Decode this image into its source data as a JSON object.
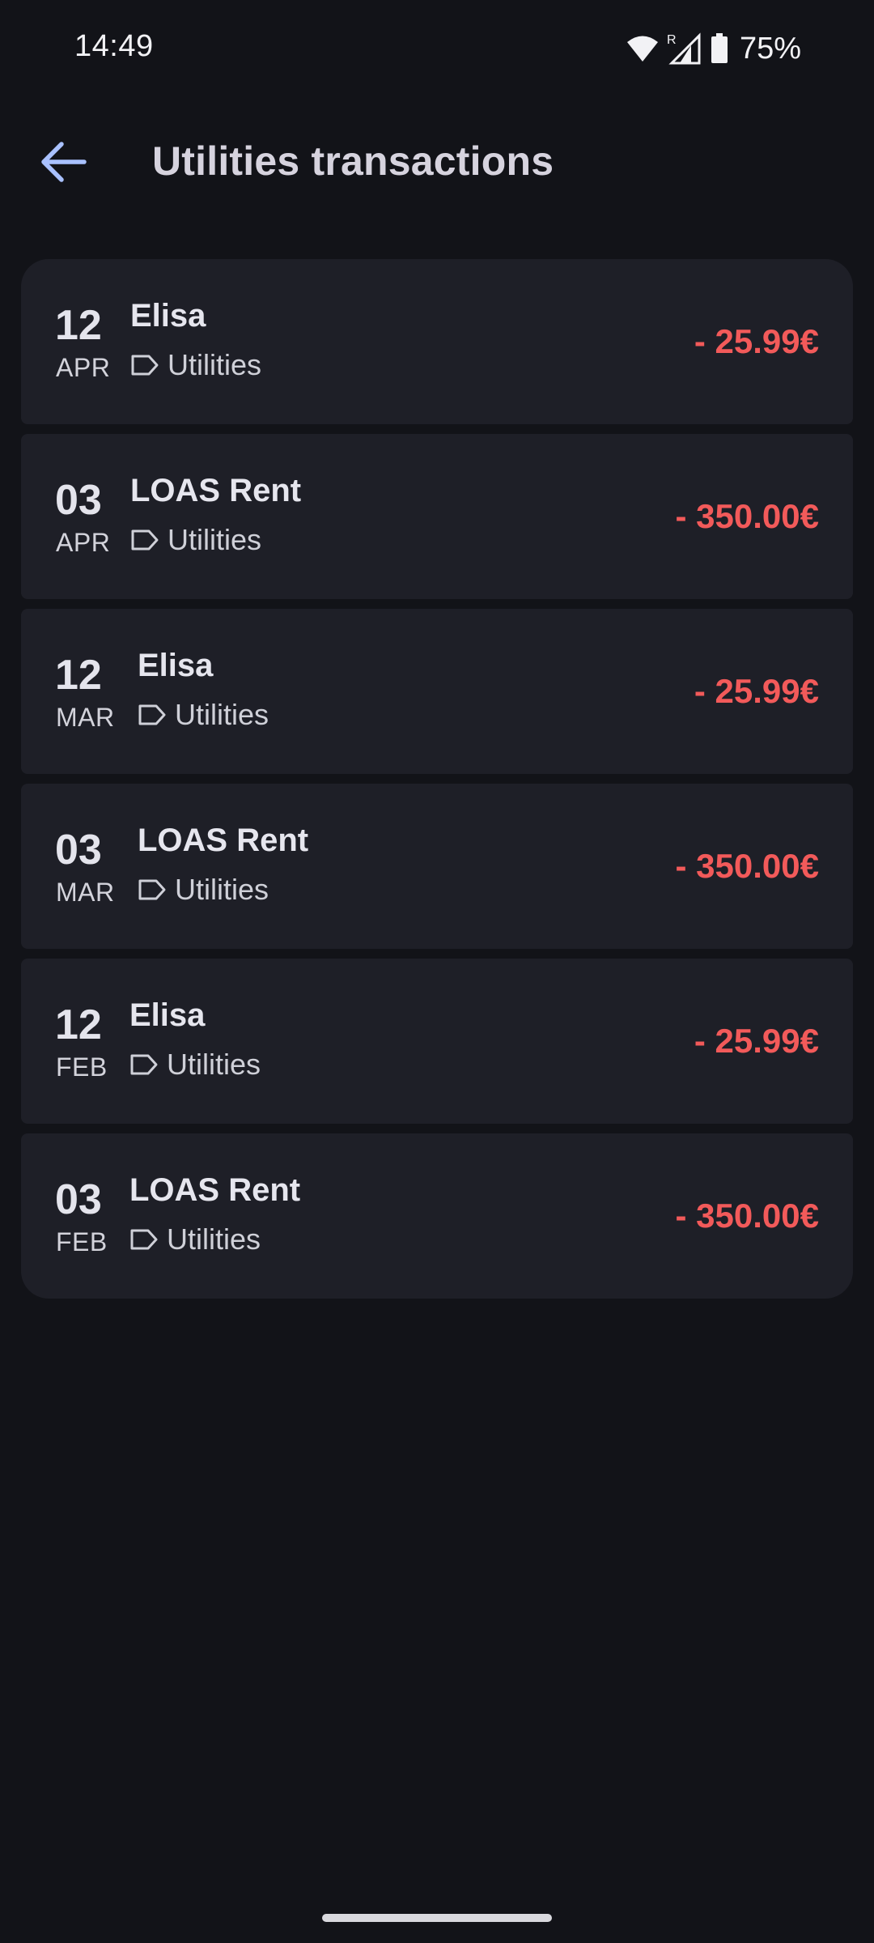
{
  "status_bar": {
    "time": "14:49",
    "battery": "75%",
    "icons": [
      "wifi-icon",
      "signal-roaming-icon",
      "battery-icon"
    ]
  },
  "app_bar": {
    "back_icon": "arrow-left-icon",
    "title": "Utilities transactions"
  },
  "colors": {
    "background": "#121318",
    "card": "#1e1f27",
    "expense": "#f25a5a",
    "accent": "#a9c1ff"
  },
  "transactions": [
    {
      "day": "12",
      "month": "APR",
      "name": "Elisa",
      "category": "Utilities",
      "amount": "- 25.99€"
    },
    {
      "day": "03",
      "month": "APR",
      "name": "LOAS Rent",
      "category": "Utilities",
      "amount": "- 350.00€"
    },
    {
      "day": "12",
      "month": "MAR",
      "name": "Elisa",
      "category": "Utilities",
      "amount": "- 25.99€"
    },
    {
      "day": "03",
      "month": "MAR",
      "name": "LOAS Rent",
      "category": "Utilities",
      "amount": "- 350.00€"
    },
    {
      "day": "12",
      "month": "FEB",
      "name": "Elisa",
      "category": "Utilities",
      "amount": "- 25.99€"
    },
    {
      "day": "03",
      "month": "FEB",
      "name": "LOAS Rent",
      "category": "Utilities",
      "amount": "- 350.00€"
    }
  ]
}
